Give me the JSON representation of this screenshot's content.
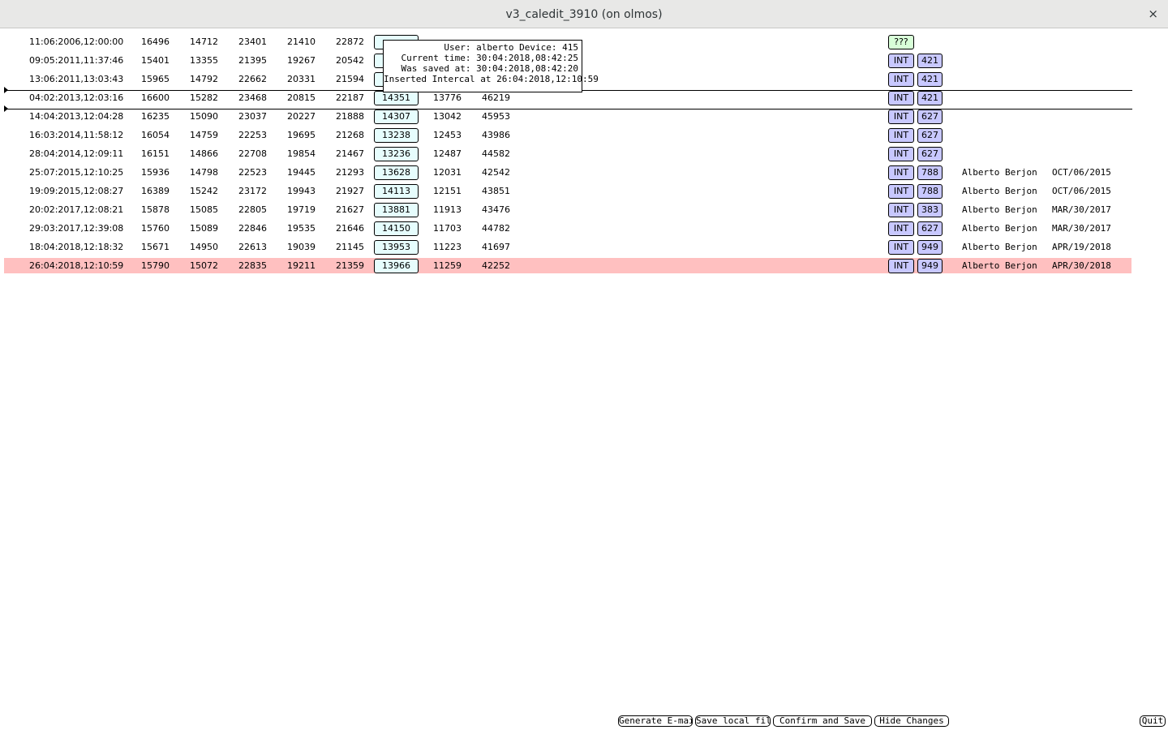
{
  "window": {
    "title": "v3_caledit_3910 (on olmos)",
    "close_glyph": "×"
  },
  "rows": [
    {
      "date": "11:06:2006,12:00:00",
      "c1": "16496",
      "c2": "14712",
      "c3": "23401",
      "c4": "21410",
      "c5": "22872",
      "box": "",
      "c7": "",
      "c8": "",
      "type": "???",
      "num": "",
      "user": "",
      "saved": ""
    },
    {
      "date": "09:05:2011,11:37:46",
      "c1": "15401",
      "c2": "13355",
      "c3": "21395",
      "c4": "19267",
      "c5": "20542",
      "box": "",
      "c7": "",
      "c8": "",
      "type": "INT",
      "num": "421",
      "user": "",
      "saved": ""
    },
    {
      "date": "13:06:2011,13:03:43",
      "c1": "15965",
      "c2": "14792",
      "c3": "22662",
      "c4": "20331",
      "c5": "21594",
      "box": "",
      "c7": "",
      "c8": "",
      "type": "INT",
      "num": "421",
      "user": "",
      "saved": ""
    },
    {
      "date": "04:02:2013,12:03:16",
      "c1": "16600",
      "c2": "15282",
      "c3": "23468",
      "c4": "20815",
      "c5": "22187",
      "box": "14351",
      "c7": "13776",
      "c8": "46219",
      "type": "INT",
      "num": "421",
      "user": "",
      "saved": ""
    },
    {
      "date": "14:04:2013,12:04:28",
      "c1": "16235",
      "c2": "15090",
      "c3": "23037",
      "c4": "20227",
      "c5": "21888",
      "box": "14307",
      "c7": "13042",
      "c8": "45953",
      "type": "INT",
      "num": "627",
      "user": "",
      "saved": ""
    },
    {
      "date": "16:03:2014,11:58:12",
      "c1": "16054",
      "c2": "14759",
      "c3": "22253",
      "c4": "19695",
      "c5": "21268",
      "box": "13238",
      "c7": "12453",
      "c8": "43986",
      "type": "INT",
      "num": "627",
      "user": "",
      "saved": ""
    },
    {
      "date": "28:04:2014,12:09:11",
      "c1": "16151",
      "c2": "14866",
      "c3": "22708",
      "c4": "19854",
      "c5": "21467",
      "box": "13236",
      "c7": "12487",
      "c8": "44582",
      "type": "INT",
      "num": "627",
      "user": "",
      "saved": ""
    },
    {
      "date": "25:07:2015,12:10:25",
      "c1": "15936",
      "c2": "14798",
      "c3": "22523",
      "c4": "19445",
      "c5": "21293",
      "box": "13628",
      "c7": "12031",
      "c8": "42542",
      "type": "INT",
      "num": "788",
      "user": "Alberto Berjon",
      "saved": "OCT/06/2015"
    },
    {
      "date": "19:09:2015,12:08:27",
      "c1": "16389",
      "c2": "15242",
      "c3": "23172",
      "c4": "19943",
      "c5": "21927",
      "box": "14113",
      "c7": "12151",
      "c8": "43851",
      "type": "INT",
      "num": "788",
      "user": "Alberto Berjon",
      "saved": "OCT/06/2015"
    },
    {
      "date": "20:02:2017,12:08:21",
      "c1": "15878",
      "c2": "15085",
      "c3": "22805",
      "c4": "19719",
      "c5": "21627",
      "box": "13881",
      "c7": "11913",
      "c8": "43476",
      "type": "INT",
      "num": "383",
      "user": "Alberto Berjon",
      "saved": "MAR/30/2017"
    },
    {
      "date": "29:03:2017,12:39:08",
      "c1": "15760",
      "c2": "15089",
      "c3": "22846",
      "c4": "19535",
      "c5": "21646",
      "box": "14150",
      "c7": "11703",
      "c8": "44782",
      "type": "INT",
      "num": "627",
      "user": "Alberto Berjon",
      "saved": "MAR/30/2017"
    },
    {
      "date": "18:04:2018,12:18:32",
      "c1": "15671",
      "c2": "14950",
      "c3": "22613",
      "c4": "19039",
      "c5": "21145",
      "box": "13953",
      "c7": "11223",
      "c8": "41697",
      "type": "INT",
      "num": "949",
      "user": "Alberto Berjon",
      "saved": "APR/19/2018"
    },
    {
      "date": "26:04:2018,12:10:59",
      "c1": "15790",
      "c2": "15072",
      "c3": "22835",
      "c4": "19211",
      "c5": "21359",
      "box": "13966",
      "c7": "11259",
      "c8": "42252",
      "type": "INT",
      "num": "949",
      "user": "Alberto Berjon",
      "saved": "APR/30/2018",
      "highlight": true
    }
  ],
  "tooltip": {
    "line1": "User: alberto Device: 415",
    "line2": "Current time: 30:04:2018,08:42:25",
    "line3": "Was saved at: 30:04:2018,08:42:20",
    "line4": "Inserted Intercal at 26:04:2018,12:10:59"
  },
  "buttons": {
    "generate_email": "Generate E-mail",
    "save_local": "Save local file",
    "confirm_save": "Confirm and Save",
    "hide_changes": "Hide Changes",
    "quit": "Quit"
  },
  "colors": {
    "highlight_row": "#ffc0c0",
    "value_box": "#e6fdfd",
    "int_tag": "#c8c8ff",
    "unknown_tag": "#d8ffd8"
  }
}
